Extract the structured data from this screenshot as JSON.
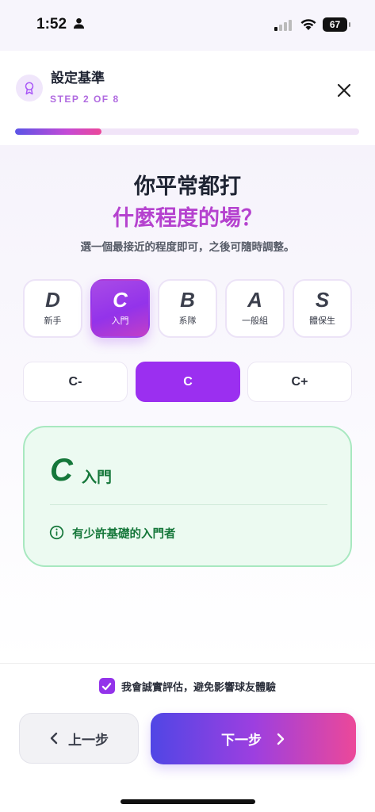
{
  "status_bar": {
    "time": "1:52",
    "battery": "67"
  },
  "header": {
    "title": "設定基準",
    "step": "STEP 2 OF 8",
    "icon": "award-icon",
    "close_icon": "close-icon"
  },
  "progress": {
    "fraction": 0.25
  },
  "question": {
    "line1": "你平常都打",
    "line2": "什麼程度的場？",
    "hint": "選一個最接近的程度即可，之後可隨時調整。"
  },
  "levels": [
    {
      "grade": "D",
      "name": "新手",
      "selected": false
    },
    {
      "grade": "C",
      "name": "入門",
      "selected": true
    },
    {
      "grade": "B",
      "name": "系隊",
      "selected": false
    },
    {
      "grade": "A",
      "name": "一般組",
      "selected": false
    },
    {
      "grade": "S",
      "name": "體保生",
      "selected": false
    }
  ],
  "sub_levels": [
    {
      "label": "C-",
      "selected": false
    },
    {
      "label": "C",
      "selected": true
    },
    {
      "label": "C+",
      "selected": false
    }
  ],
  "selected_info": {
    "grade": "C",
    "name": "入門",
    "description": "有少許基礎的入門者",
    "icon": "info-icon"
  },
  "footer": {
    "consent_checked": true,
    "consent_text": "我會誠實評估，避免影響球友體驗",
    "prev_label": "上一步",
    "next_label": "下一步"
  },
  "colors": {
    "accent_purple": "#9333ea",
    "accent_pink": "#ec4899",
    "accent_indigo": "#5046e5",
    "success_green": "#15773a"
  }
}
